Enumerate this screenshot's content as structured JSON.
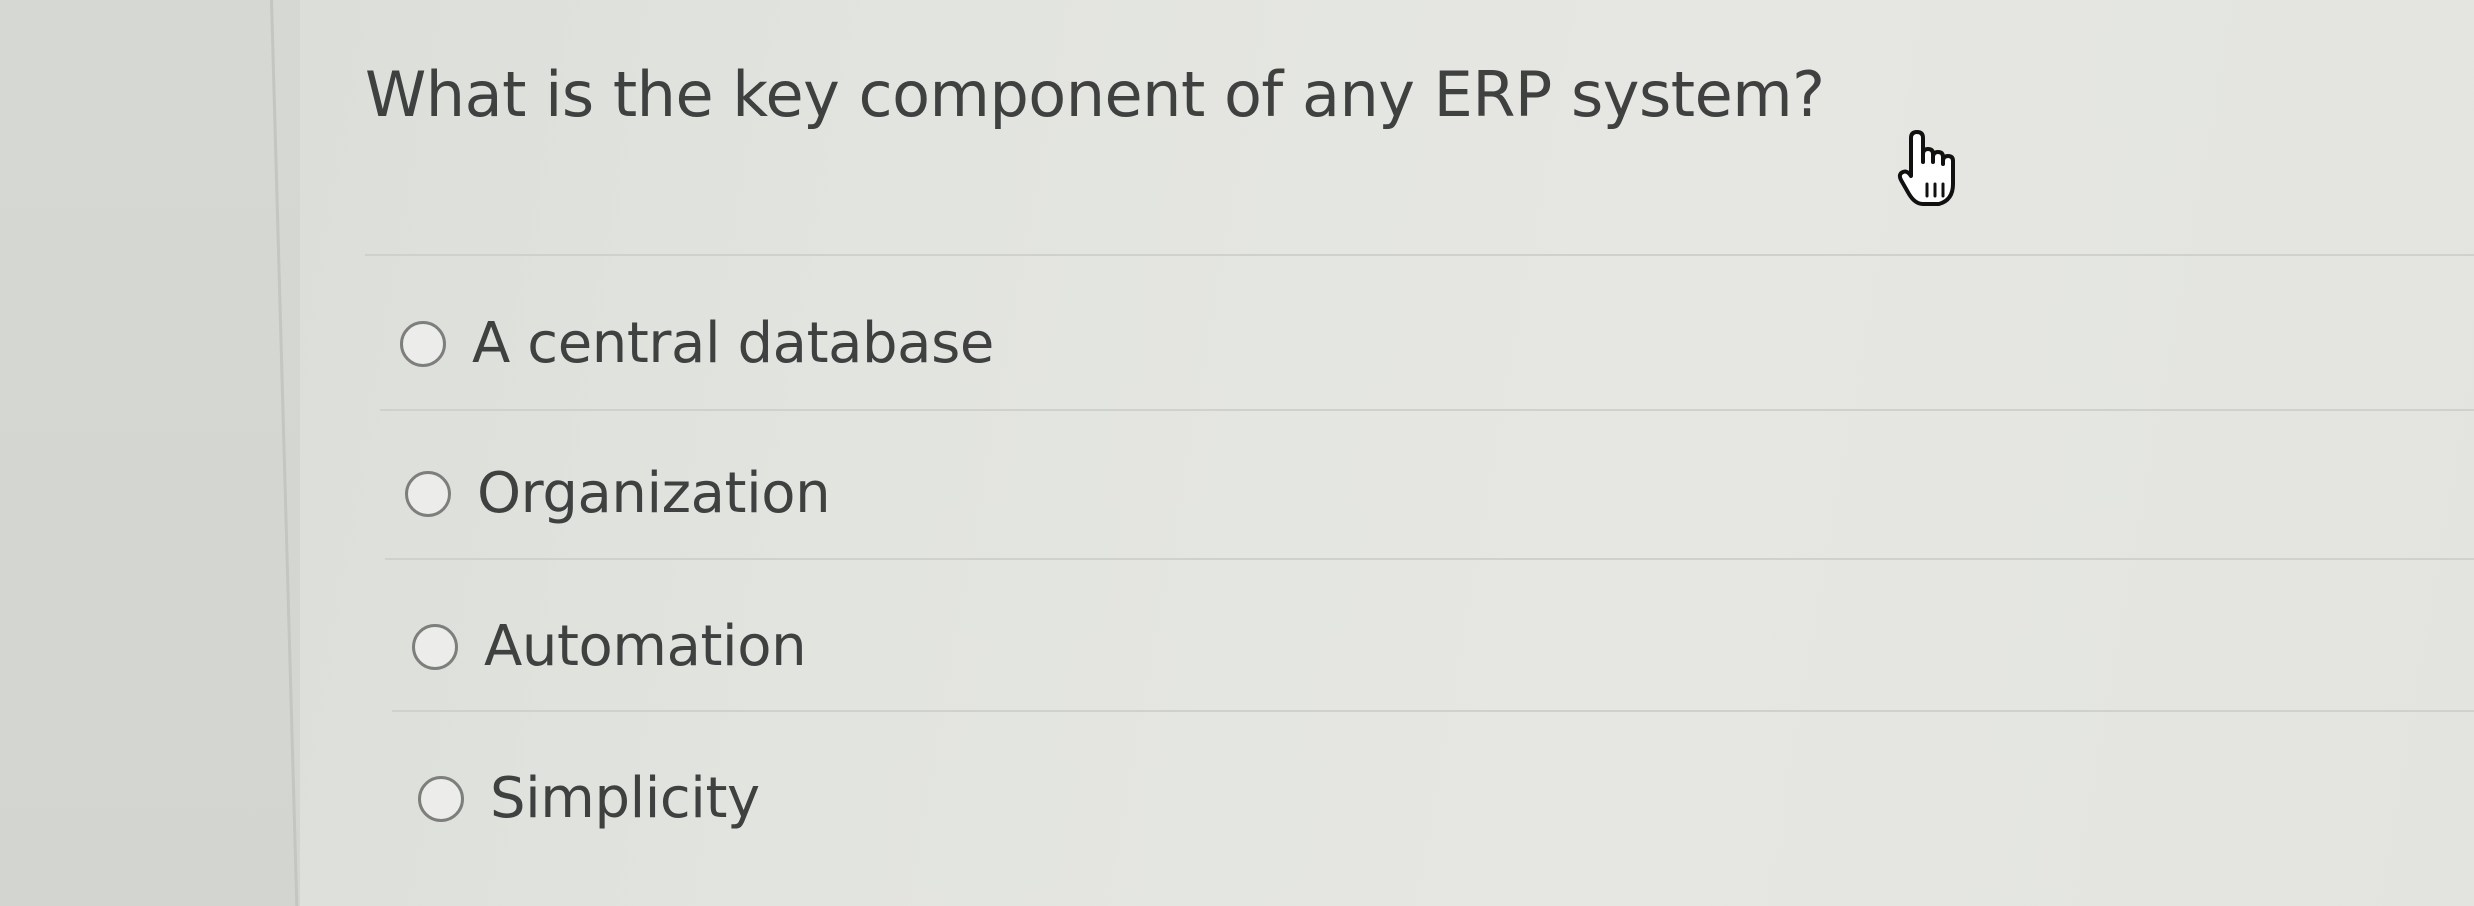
{
  "question": {
    "text": "What is the key component of any ERP system?"
  },
  "options": [
    {
      "label": "A central database",
      "selected": false
    },
    {
      "label": "Organization",
      "selected": false
    },
    {
      "label": "Automation",
      "selected": false
    },
    {
      "label": "Simplicity",
      "selected": false
    }
  ],
  "cursor": {
    "icon": "hand-pointer-icon"
  },
  "colors": {
    "background": "#e3e4e0",
    "text": "#3f4040",
    "divider": "#cfd1cc",
    "radio_border": "#7d7f7d"
  }
}
